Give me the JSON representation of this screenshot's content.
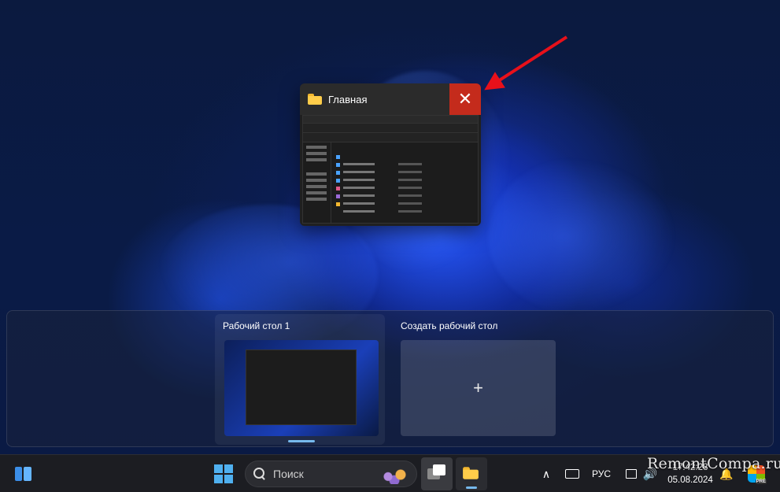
{
  "window_preview": {
    "title": "Главная",
    "close_glyph": "✕",
    "icon": "folder-icon"
  },
  "desktops": {
    "desktop1_label": "Рабочий стол 1",
    "new_desktop_label": "Создать рабочий стол",
    "new_desktop_glyph": "+"
  },
  "taskbar": {
    "search_placeholder": "Поиск",
    "language": "РУС",
    "time": "17:42:28",
    "date": "05.08.2024",
    "chevron": "∧",
    "volume_glyph": "🔊",
    "bell_glyph": "🔔"
  },
  "watermark": "RemontCompa.ru",
  "colors": {
    "close_red": "#c42b1c",
    "accent_blue": "#76b9ed",
    "arrow_red": "#e8101a"
  }
}
